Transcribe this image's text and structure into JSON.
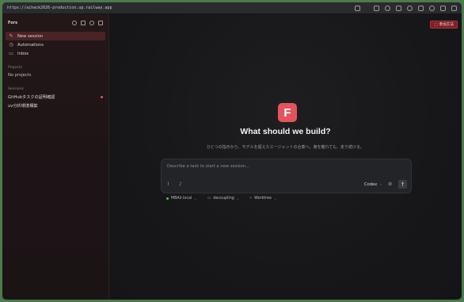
{
  "browser": {
    "url": "https://aihack2026-production.up.railway.app"
  },
  "sidebar": {
    "app_name": "Fors",
    "nav": [
      {
        "label": "New session",
        "icon": "compose-icon",
        "active": true
      },
      {
        "label": "Automations",
        "icon": "clock-icon",
        "active": false
      },
      {
        "label": "Inbox",
        "icon": "inbox-icon",
        "active": false
      }
    ],
    "projects_heading": "Projects",
    "projects_empty": "No projects",
    "sessions_heading": "Sessions",
    "sessions": [
      {
        "label": "GitHubタスクの証明確認",
        "unread": true
      },
      {
        "label": "uv分析環境構築",
        "unread": false
      }
    ]
  },
  "main": {
    "join_button": "参加方法",
    "logo_letter": "F",
    "headline": "What should we build?",
    "subline": "ひとつの指示から、モデルを超えたエージェントの合奏へ。席を離れても、走り続ける。",
    "composer": {
      "placeholder": "Describe a task to start a new session...",
      "agent": "Codex"
    },
    "meta": {
      "machine": "MBAir.local",
      "folder": "decoupling",
      "mode": "Worktree"
    }
  },
  "colors": {
    "accent": "#e2555c",
    "active_bg": "#4a2326",
    "status_green": "#4fbf5a"
  }
}
